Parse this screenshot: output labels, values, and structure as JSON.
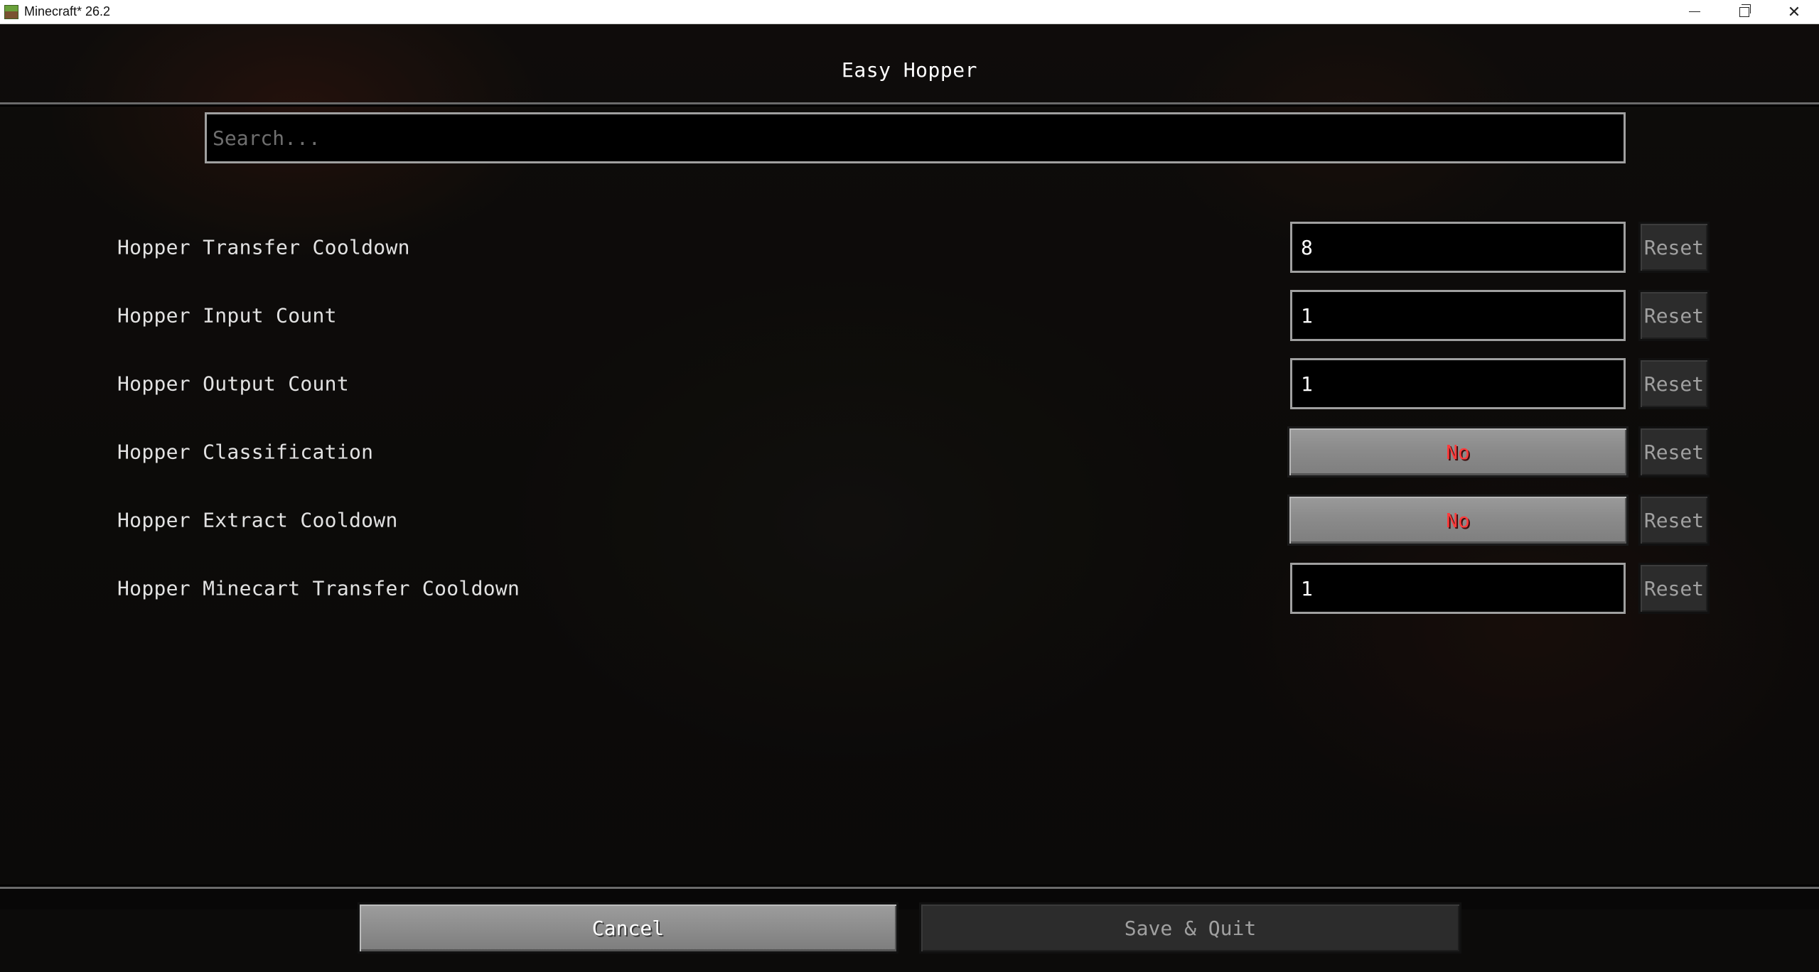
{
  "window": {
    "title": "Minecraft* 26.2",
    "controls": {
      "minimize": "minimize-icon",
      "restore": "restore-icon",
      "close": "✕"
    }
  },
  "screen": {
    "title": "Easy Hopper"
  },
  "search": {
    "placeholder": "Search...",
    "value": ""
  },
  "options": [
    {
      "label": "Hopper Transfer Cooldown",
      "type": "number",
      "value": "8",
      "reset_label": "Reset"
    },
    {
      "label": "Hopper Input Count",
      "type": "number",
      "value": "1",
      "reset_label": "Reset"
    },
    {
      "label": "Hopper Output Count",
      "type": "number",
      "value": "1",
      "reset_label": "Reset"
    },
    {
      "label": "Hopper Classification",
      "type": "toggle",
      "value": "No",
      "reset_label": "Reset"
    },
    {
      "label": "Hopper Extract Cooldown",
      "type": "toggle",
      "value": "No",
      "reset_label": "Reset"
    },
    {
      "label": "Hopper Minecart Transfer Cooldown",
      "type": "number",
      "value": "1",
      "reset_label": "Reset"
    }
  ],
  "footer": {
    "cancel_label": "Cancel",
    "save_label": "Save & Quit"
  },
  "colors": {
    "toggle_off_text": "#ff3b3b",
    "field_border": "#a0a0a0",
    "disabled_text": "#a0a0a0"
  }
}
